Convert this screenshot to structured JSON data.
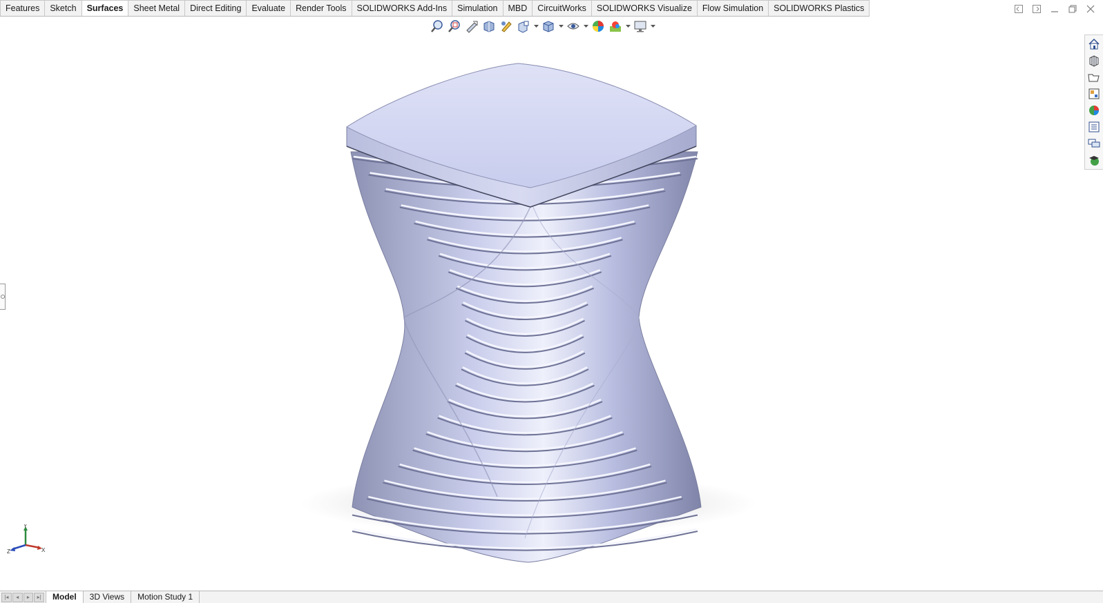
{
  "tabs": [
    {
      "label": "Features",
      "active": false
    },
    {
      "label": "Sketch",
      "active": false
    },
    {
      "label": "Surfaces",
      "active": true
    },
    {
      "label": "Sheet Metal",
      "active": false
    },
    {
      "label": "Direct Editing",
      "active": false
    },
    {
      "label": "Evaluate",
      "active": false
    },
    {
      "label": "Render Tools",
      "active": false
    },
    {
      "label": "SOLIDWORKS Add-Ins",
      "active": false
    },
    {
      "label": "Simulation",
      "active": false
    },
    {
      "label": "MBD",
      "active": false
    },
    {
      "label": "CircuitWorks",
      "active": false
    },
    {
      "label": "SOLIDWORKS Visualize",
      "active": false
    },
    {
      "label": "Flow Simulation",
      "active": false
    },
    {
      "label": "SOLIDWORKS Plastics",
      "active": false
    }
  ],
  "window_controls": [
    "tile-left-icon",
    "tile-right-icon",
    "minimize-icon",
    "restore-icon",
    "close-icon"
  ],
  "view_toolbar": [
    "zoom-to-fit-icon",
    "zoom-to-area-icon",
    "previous-view-icon",
    "section-view-icon",
    "dynamic-annotation-icon",
    "view-orientation-icon",
    "display-style-icon",
    "hide-show-items-icon",
    "edit-appearance-icon",
    "apply-scene-icon",
    "view-settings-icon"
  ],
  "task_pane": [
    "home-icon",
    "design-library-icon",
    "file-explorer-icon",
    "view-palette-icon",
    "appearances-icon",
    "custom-properties-icon",
    "forum-icon",
    "learning-icon"
  ],
  "triad": {
    "x": "X",
    "y": "Y",
    "z": "Z"
  },
  "bottom_tabs": [
    {
      "label": "Model",
      "active": true
    },
    {
      "label": "3D Views",
      "active": false
    },
    {
      "label": "Motion Study 1",
      "active": false
    }
  ],
  "colors": {
    "model_light": "#e6e9f7",
    "model_mid": "#c4c9ea",
    "model_dark": "#7c80a2",
    "axis_x": "#c0392b",
    "axis_y": "#2e8b3e",
    "axis_z": "#2a4bb8"
  }
}
